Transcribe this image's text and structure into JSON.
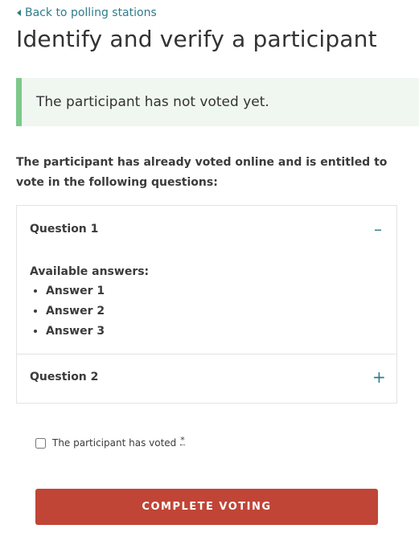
{
  "header": {
    "back_link": "Back to polling stations",
    "title": "Identify and verify a participant"
  },
  "notice": {
    "text": "The participant has not voted yet."
  },
  "intro": {
    "text": "The participant has already voted online and is entitled to vote in the following questions:"
  },
  "questions": [
    {
      "label": "Question 1",
      "expanded": true,
      "toggle": "–",
      "available_label": "Available answers:",
      "answers": [
        "Answer 1",
        "Answer 2",
        "Answer 3"
      ]
    },
    {
      "label": "Question 2",
      "expanded": false,
      "toggle": "+"
    }
  ],
  "voted_checkbox": {
    "label": "The participant has voted",
    "required_mark": "*",
    "checked": false
  },
  "complete_button": {
    "label": "COMPLETE VOTING"
  },
  "colors": {
    "accent": "#2e7d8a",
    "notice_bg": "#f0f7f0",
    "notice_border": "#7cc98b",
    "button_bg": "#c04536"
  }
}
